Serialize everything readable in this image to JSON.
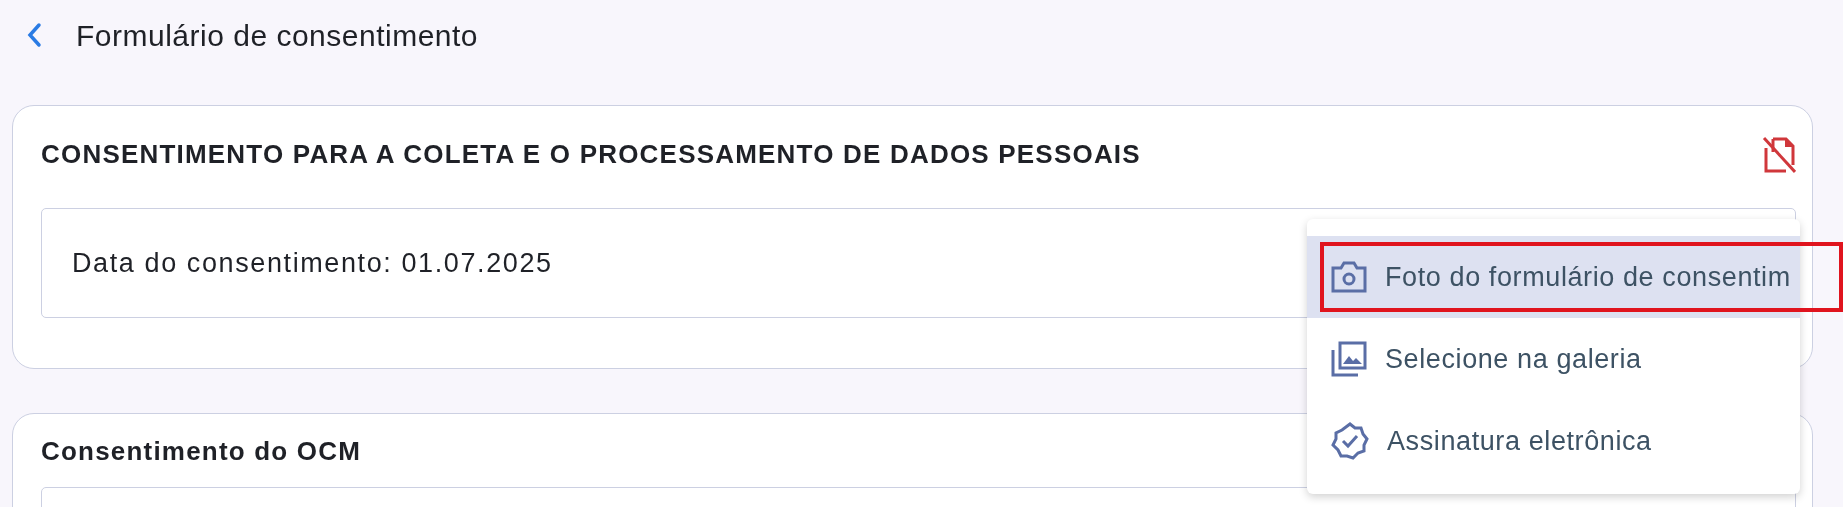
{
  "header": {
    "title": "Formulário de consentimento"
  },
  "cards": [
    {
      "title": "CONSENTIMENTO PARA A COLETA E O PROCESSAMENTO DE DADOS PESSOAIS",
      "has_status_icon": true,
      "field": "Data do consentimento: 01.07.2025"
    },
    {
      "title": "Consentimento do OCM",
      "has_status_icon": false
    }
  ],
  "menu": {
    "items": [
      {
        "kind": "camera",
        "label": "Foto do formulário de consentim",
        "selected": true,
        "outlined": true
      },
      {
        "kind": "gallery",
        "label": "Selecione na galeria",
        "selected": false,
        "outlined": false
      },
      {
        "kind": "signature",
        "label": "Assinatura eletrônica",
        "selected": false,
        "outlined": false
      }
    ]
  }
}
